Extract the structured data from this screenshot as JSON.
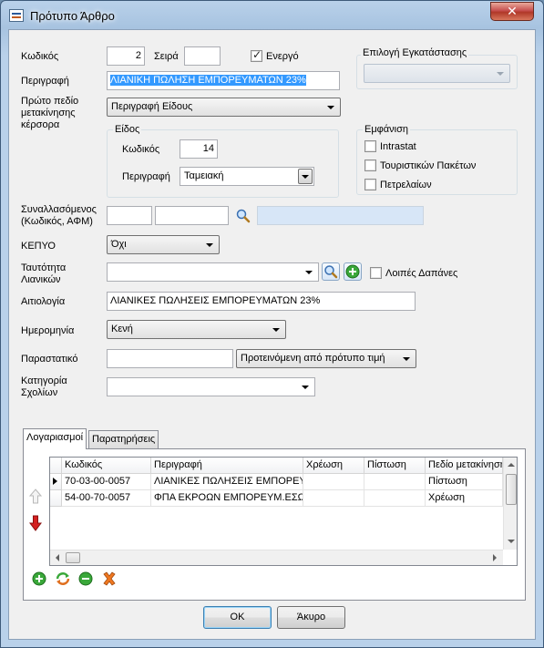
{
  "window": {
    "title": "Πρότυπο Άρθρο",
    "close_symbol": "✕"
  },
  "form": {
    "code_label": "Κωδικός",
    "code_value": "2",
    "series_label": "Σειρά",
    "series_value": "",
    "active_label": "Ενεργό",
    "active_checked": true,
    "description_label": "Περιγραφή",
    "description_value": "ΛΙΑΝΙΚΗ ΠΩΛΗΣΗ ΕΜΠΟΡΕΥΜΑΤΩΝ 23%",
    "first_field_label": "Πρώτο πεδίο μετακίνησης κέρσορα",
    "first_field_value": "Περιγραφή Είδους",
    "installation_label": "Επιλογή Εγκατάστασης",
    "installation_value": "",
    "kind": {
      "title": "Είδος",
      "code_label": "Κωδικός",
      "code_value": "14",
      "description_label": "Περιγραφή",
      "description_value": "Ταμειακή"
    },
    "display": {
      "title": "Εμφάνιση",
      "options": [
        {
          "label": "Intrastat",
          "checked": false
        },
        {
          "label": "Τουριστικών Πακέτων",
          "checked": false
        },
        {
          "label": "Πετρελαίων",
          "checked": false
        }
      ]
    },
    "trader_label": "Συναλλασόμενος (Κωδικός, ΑΦΜ)",
    "trader_code": "",
    "trader_afm": "",
    "trader_name": "",
    "kepyo_label": "ΚΕΠΥΟ",
    "kepyo_value": "Όχι",
    "retail_id_label": "Ταυτότητα Λιανικών",
    "retail_id_value": "",
    "other_expenses_label": "Λοιπές Δαπάνες",
    "reason_label": "Αιτιολογία",
    "reason_value": "ΛΙΑΝΙΚΕΣ ΠΩΛΗΣΕΙΣ ΕΜΠΟΡΕΥΜΑΤΩΝ 23%",
    "date_label": "Ημερομηνία",
    "date_value": "Κενή",
    "document_label": "Παραστατικό",
    "document_value": "",
    "document_option": "Προτεινόμενη από πρότυπο τιμή",
    "comment_category_label": "Κατηγορία Σχολίων",
    "comment_category_value": ""
  },
  "tabs": [
    {
      "label": "Λογαριασμοί",
      "active": true
    },
    {
      "label": "Παρατηρήσεις",
      "active": false
    }
  ],
  "grid": {
    "columns": [
      "Κωδικός",
      "Περιγραφή",
      "Χρέωση",
      "Πίστωση",
      "Πεδίο μετακίνηση"
    ],
    "rows": [
      {
        "code": "70-03-00-0057",
        "description": "ΛΙΑΝΙΚΕΣ ΠΩΛΗΣΕΙΣ ΕΜΠΟΡΕΥΜ",
        "debit": "",
        "credit": "",
        "field": "Πίστωση",
        "current": true
      },
      {
        "code": "54-00-70-0057",
        "description": "ΦΠΑ ΕΚΡΟΩΝ ΕΜΠΟΡΕΥΜ.ΕΣΩΤΕ",
        "debit": "",
        "credit": "",
        "field": "Χρέωση",
        "current": false
      }
    ]
  },
  "buttons": {
    "ok": "OK",
    "cancel": "Άκυρο"
  }
}
